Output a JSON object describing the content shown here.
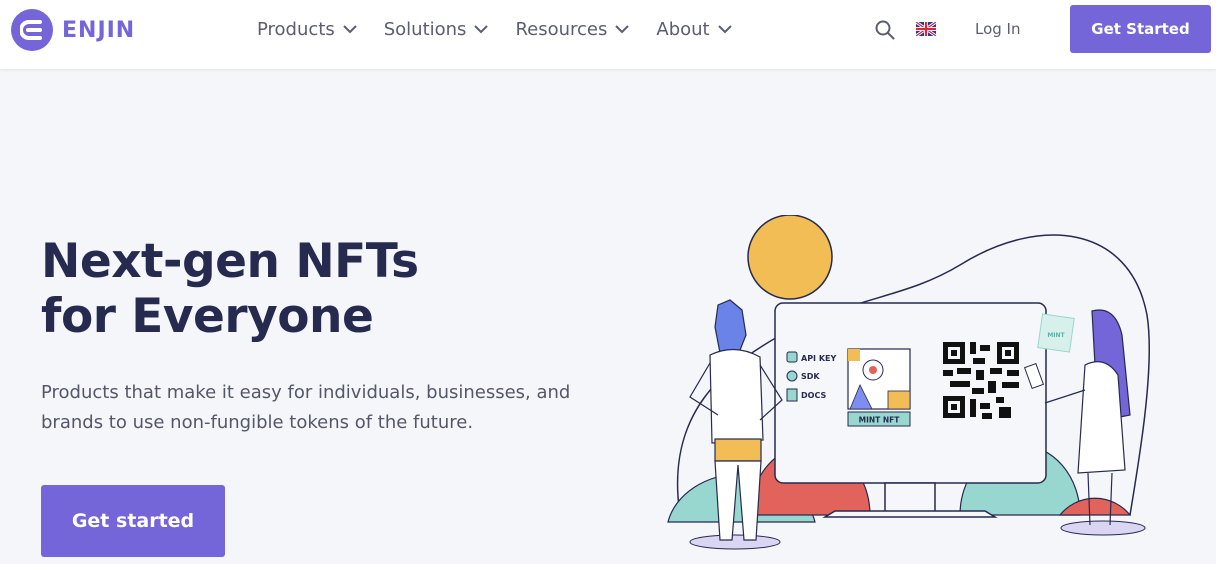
{
  "brand": {
    "name": "ENJIN",
    "accent": "#7466d9",
    "text_dark": "#262a4f"
  },
  "nav": {
    "items": [
      {
        "label": "Products"
      },
      {
        "label": "Solutions"
      },
      {
        "label": "Resources"
      },
      {
        "label": "About"
      }
    ],
    "search_icon": "search-icon",
    "language_icon": "uk-flag-icon",
    "login_label": "Log In",
    "cta_label": "Get Started"
  },
  "hero": {
    "title_line1": "Next-gen NFTs",
    "title_line2": "for Everyone",
    "subtitle_line1": "Products that make it easy for individuals, businesses, and",
    "subtitle_line2": "brands to use non-fungible tokens of the future.",
    "cta_label": "Get started"
  },
  "illustration": {
    "labels": {
      "api_key": "API KEY",
      "sdk": "SDK",
      "docs": "DOCS",
      "mint": "MINT NFT",
      "badge": "MINT"
    },
    "colors": {
      "sun": "#f2bd55",
      "teal": "#97d7cf",
      "coral": "#e2635b",
      "purple": "#7466d9",
      "blue": "#6a83e8"
    }
  }
}
